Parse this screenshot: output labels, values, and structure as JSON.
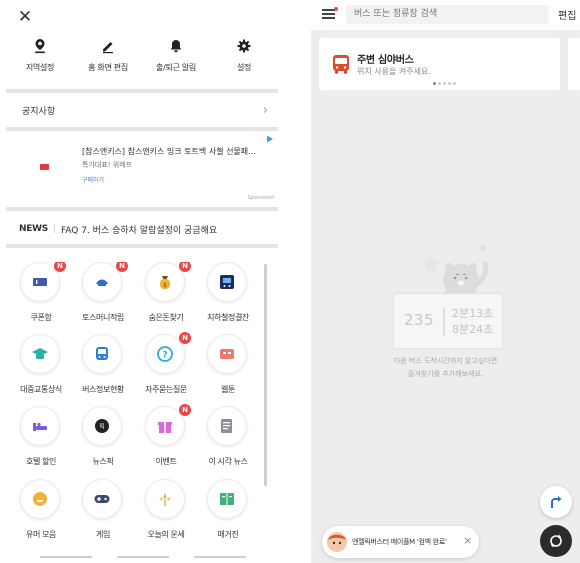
{
  "left": {
    "quick_menu": [
      {
        "label": "지역설정",
        "icon": "location-pin-icon"
      },
      {
        "label": "홈 화면 편집",
        "icon": "pencil-icon"
      },
      {
        "label": "출/퇴근 알림",
        "icon": "bell-icon"
      },
      {
        "label": "설정",
        "icon": "gear-icon"
      }
    ],
    "notice_label": "공지사항",
    "ad": {
      "title": "[참스앤키스] 참스앤키스 밍크 토트백 사첼 선물패키…",
      "subtitle": "특가대표! 위메프",
      "link": "구매하기",
      "sponsored": "Sponsored"
    },
    "news": {
      "tag": "NEWS",
      "text": "FAQ 7. 버스 승하차 알람설정이 궁금해요"
    },
    "grid": [
      {
        "label": "쿠폰함",
        "icon": "coupon-icon",
        "badge": "N",
        "color": "#3f5aa8"
      },
      {
        "label": "토스머니적립",
        "icon": "toss-icon",
        "badge": "N",
        "color": "#2f6ad9"
      },
      {
        "label": "숨은돈찾기",
        "icon": "money-bag-icon",
        "badge": "N",
        "color": "#f2b233"
      },
      {
        "label": "지하철정결잔",
        "icon": "subway-icon",
        "badge": "",
        "color": "#1d2c5a"
      },
      {
        "label": "대중교통상식",
        "icon": "graduation-cap-icon",
        "badge": "",
        "color": "#2bb0a8"
      },
      {
        "label": "버스정보현황",
        "icon": "bus-icon",
        "badge": "",
        "color": "#2a7fd4"
      },
      {
        "label": "자주묻는질문",
        "icon": "question-icon",
        "badge": "N",
        "color": "#2fa7d8"
      },
      {
        "label": "웹툰",
        "icon": "webtoon-icon",
        "badge": "",
        "color": "#f07a6a"
      },
      {
        "label": "호텔 할인",
        "icon": "bed-icon",
        "badge": "",
        "color": "#7b5cd6"
      },
      {
        "label": "뉴스픽",
        "icon": "newspick-icon",
        "badge": "",
        "color": "#222222"
      },
      {
        "label": "이벤트",
        "icon": "gift-icon",
        "badge": "N",
        "color": "#d96ad6"
      },
      {
        "label": "이 시각 뉴스",
        "icon": "news-icon",
        "badge": "",
        "color": "#8a8f9a"
      },
      {
        "label": "유머 모음",
        "icon": "smile-icon",
        "badge": "",
        "color": "#f3b13a"
      },
      {
        "label": "게임",
        "icon": "gamepad-icon",
        "badge": "",
        "color": "#3b4b6b"
      },
      {
        "label": "오늘의 운세",
        "icon": "fortune-icon",
        "badge": "",
        "color": "#e2b437"
      },
      {
        "label": "매거진",
        "icon": "magazine-icon",
        "badge": "",
        "color": "#3fb27a"
      }
    ]
  },
  "right": {
    "search_placeholder": "버스 또는 정류장 검색",
    "edit_label": "편집",
    "card": {
      "title": "주변 심야버스",
      "subtitle": "위치 사용을 켜주세요."
    },
    "empty": {
      "stop_number": "235",
      "time1": "2분13초",
      "time2": "8분24초",
      "line1": "다음 버스 도착시간까지 알고싶다면",
      "line2": "즐겨찾기를 추가해보세요."
    },
    "toast": "엔젤릭버스터 메이플M '컴백 완료'"
  },
  "colors": {
    "badge": "#e84747",
    "bus_red": "#e04a2f",
    "panel_bg": "#ededed"
  }
}
